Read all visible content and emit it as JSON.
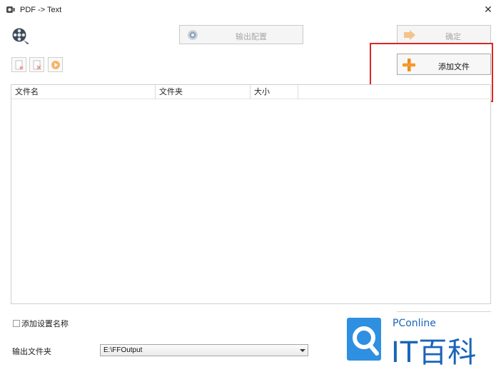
{
  "window": {
    "title": "PDF -> Text",
    "close_glyph": "✕"
  },
  "toolbar": {
    "output_config_label": "输出配置",
    "confirm_label": "确定",
    "add_file_label": "添加文件"
  },
  "icons": {
    "app": "film-reel-icon",
    "add_file": "plus-icon",
    "confirm": "arrow-icon",
    "output_config": "gear-icon",
    "tools": [
      "new-file-icon",
      "delete-file-icon",
      "play-icon"
    ]
  },
  "table": {
    "columns": [
      "文件名",
      "文件夹",
      "大小",
      ""
    ],
    "rows": []
  },
  "options": {
    "add_setting_name_label": "添加设置名称",
    "add_setting_name_checked": false
  },
  "output": {
    "folder_label": "输出文件夹",
    "folder_value": "E:\\FFOutput"
  },
  "watermark": {
    "brand_small": "PConline",
    "brand_large": "IT百科"
  },
  "colors": {
    "highlight": "#d8282a",
    "plus_orange": "#f08a1c",
    "brand_blue": "#1a64b8"
  }
}
